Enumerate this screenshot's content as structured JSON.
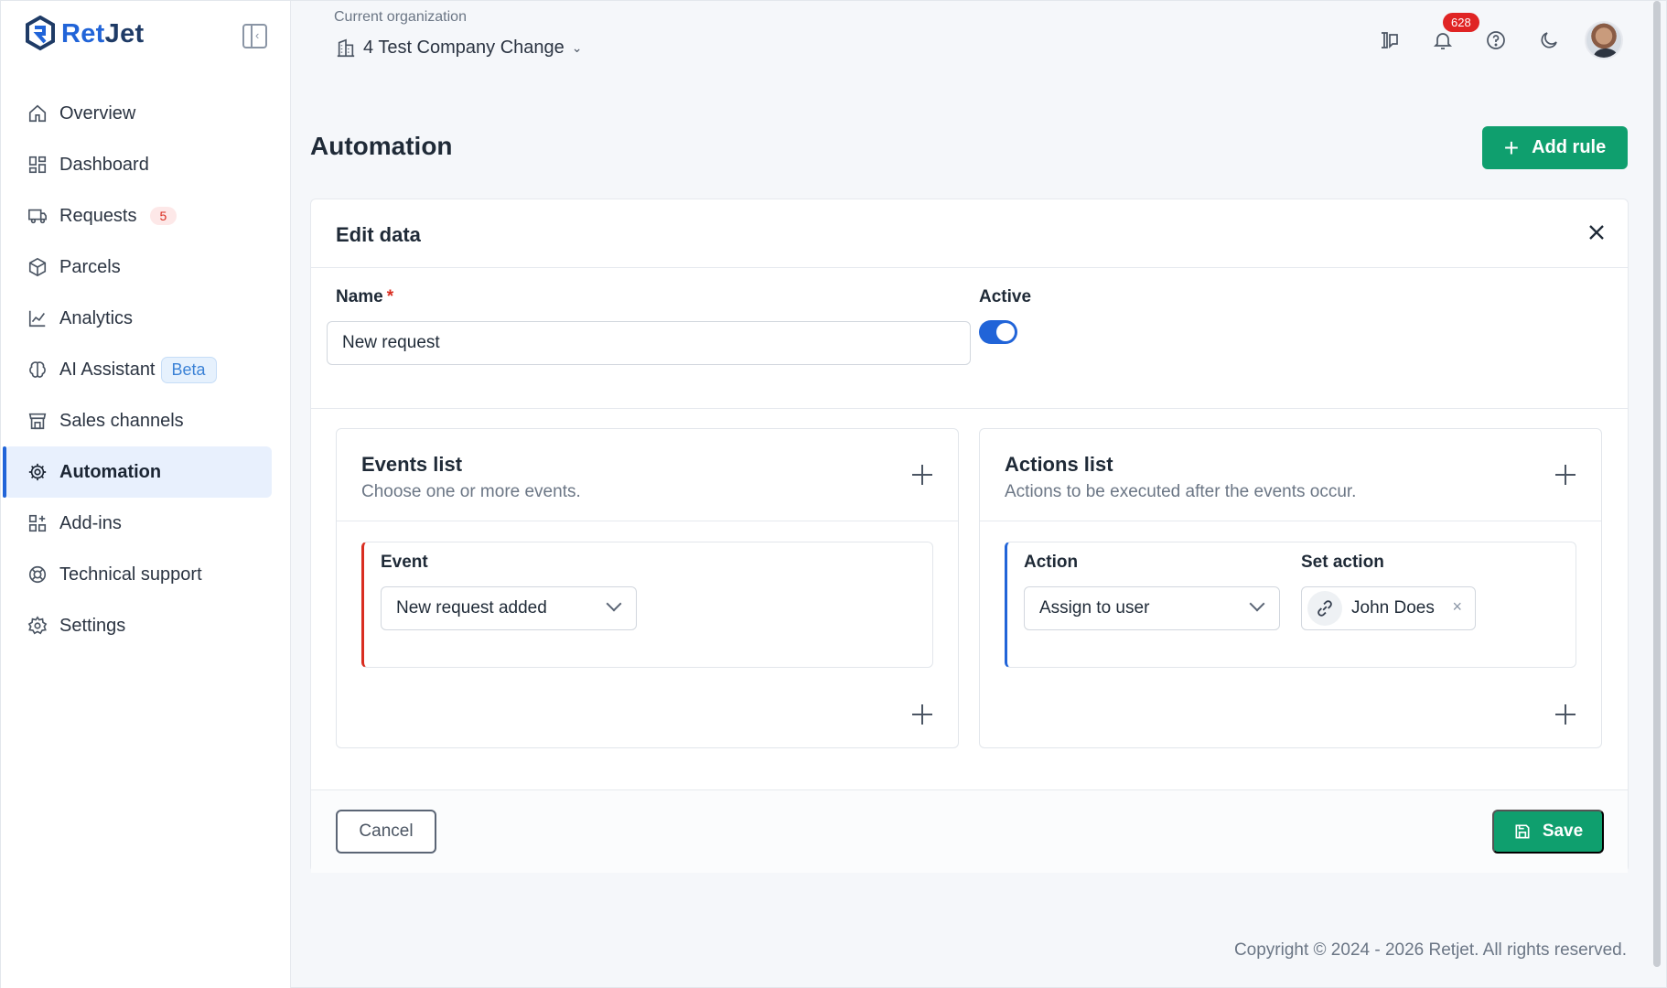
{
  "brand": {
    "name_part1": "Ret",
    "name_part2": "Jet"
  },
  "sidebar": {
    "items": [
      {
        "label": "Overview",
        "icon": "home-icon"
      },
      {
        "label": "Dashboard",
        "icon": "dashboard-icon"
      },
      {
        "label": "Requests",
        "icon": "requests-icon",
        "badge": "5"
      },
      {
        "label": "Parcels",
        "icon": "box-icon"
      },
      {
        "label": "Analytics",
        "icon": "chart-icon"
      },
      {
        "label": "AI Assistant",
        "icon": "brain-icon",
        "tag": "Beta"
      },
      {
        "label": "Sales channels",
        "icon": "store-icon"
      },
      {
        "label": "Automation",
        "icon": "automation-gear-icon",
        "active": true
      },
      {
        "label": "Add-ins",
        "icon": "addins-icon"
      },
      {
        "label": "Technical support",
        "icon": "lifebuoy-icon"
      },
      {
        "label": "Settings",
        "icon": "gear-icon"
      }
    ]
  },
  "header": {
    "org_label": "Current organization",
    "org_name": "4 Test Company Change",
    "notification_count": "628"
  },
  "page": {
    "title": "Automation",
    "add_rule_label": "Add rule"
  },
  "edit": {
    "title": "Edit data",
    "name_label": "Name",
    "required_mark": "*",
    "name_value": "New request",
    "active_label": "Active",
    "active": true
  },
  "events": {
    "title": "Events list",
    "subtitle": "Choose one or more events.",
    "event_label": "Event",
    "event_value": "New request added"
  },
  "actions": {
    "title": "Actions list",
    "subtitle": "Actions to be executed after the events occur.",
    "action_label": "Action",
    "action_value": "Assign to user",
    "set_action_label": "Set action",
    "set_action_value": "John Does"
  },
  "footer": {
    "cancel_label": "Cancel",
    "save_label": "Save"
  },
  "copyright": "Copyright © 2024 - 2026 Retjet. All rights reserved.",
  "colors": {
    "primary": "#2164d8",
    "success": "#0f9f6e",
    "danger": "#d92d20"
  }
}
